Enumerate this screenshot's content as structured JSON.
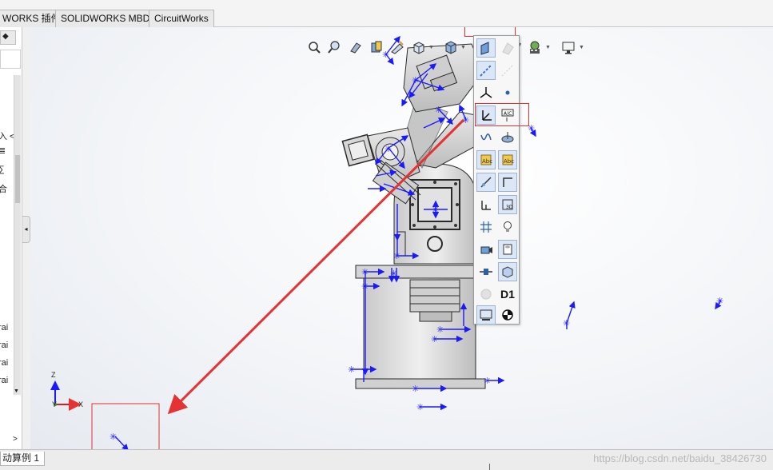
{
  "commandmanager": {
    "tabs": [
      {
        "label": "WORKS 插件"
      },
      {
        "label": "SOLIDWORKS MBD"
      },
      {
        "label": "CircuitWorks"
      }
    ]
  },
  "feature_tree": {
    "fragments": [
      "入 <",
      "≣",
      "∑",
      "合",
      "rai",
      "rai",
      "rai",
      "rai"
    ]
  },
  "heads_up_toolbar": {
    "icons": [
      "zoom-to-fit-icon",
      "zoom-to-area-icon",
      "previous-view-icon",
      "section-view-icon",
      "dynamic-annotation-views-icon",
      "view-orientation-icon",
      "display-style-icon",
      "hide-show-items-icon",
      "edit-appearance-icon",
      "apply-scene-icon",
      "view-settings-icon"
    ]
  },
  "flyout": {
    "title": "hide-show-items",
    "items": [
      {
        "icon": "view-planes-icon"
      },
      {
        "icon": "view-axes-icon"
      },
      {
        "icon": "view-temporary-axes-icon"
      },
      {
        "icon": "view-points-icon"
      },
      {
        "icon": "view-origins-icon"
      },
      {
        "icon": "view-coordinate-systems-icon"
      },
      {
        "icon": "view-curves-icon"
      },
      {
        "icon": "view-parting-lines-icon"
      },
      {
        "icon": "view-annotations-icon"
      },
      {
        "icon": "view-all-annotations-icon"
      },
      {
        "icon": "view-sketch-relations-icon"
      },
      {
        "icon": "view-sketches-icon"
      },
      {
        "icon": "view-dimension-names-icon"
      },
      {
        "icon": "view-3d-sketch-planes-icon"
      },
      {
        "icon": "view-grid-icon"
      },
      {
        "icon": "view-lights-icon"
      },
      {
        "icon": "view-cameras-icon"
      },
      {
        "icon": "view-decals-icon"
      },
      {
        "icon": "view-routing-points-icon"
      },
      {
        "icon": "view-weld-bead-icon"
      },
      {
        "icon": "view-mates-icon"
      },
      {
        "icon": "view-dimension-label-icon",
        "text": "D1"
      },
      {
        "icon": "view-live-section-planes-icon"
      },
      {
        "icon": "view-center-of-mass-icon"
      }
    ]
  },
  "triad": {
    "z_label": "Z",
    "x_label": "X",
    "y_label": "Y"
  },
  "document": {
    "sheet_tab": "动算例 1"
  },
  "watermark": {
    "text": "https://blog.csdn.net/baidu_38426730"
  },
  "colors": {
    "highlight_box": "#e03030",
    "arrow": "#e53333",
    "coordinate_system": "#1a1aff",
    "model_steel": "#d9d9d9"
  }
}
